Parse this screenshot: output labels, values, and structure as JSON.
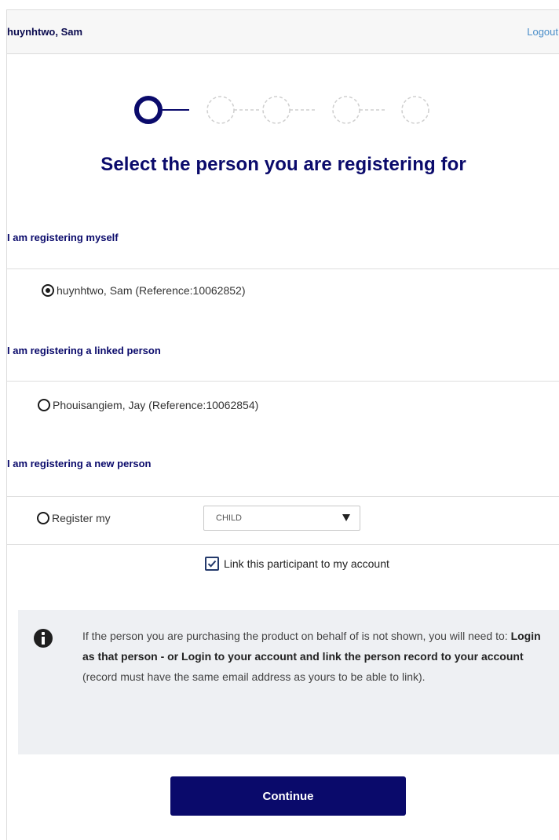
{
  "header": {
    "user_name": "huynhtwo, Sam",
    "logout_label": "Logout"
  },
  "stepper": {
    "total_steps": 5,
    "current_step": 1
  },
  "page": {
    "title": "Select the person you are registering for"
  },
  "sections": {
    "myself": {
      "heading": "I am registering myself",
      "option_label": "huynhtwo, Sam (Reference:10062852)",
      "selected": true
    },
    "linked": {
      "heading": "I am registering a linked person",
      "option_label": "Phouisangiem, Jay (Reference:10062854)",
      "selected": false
    },
    "new_person": {
      "heading": "I am registering a new person",
      "option_label": "Register my",
      "selected": false,
      "relation_select": {
        "selected_value": "CHILD"
      },
      "link_checkbox": {
        "label": "Link this participant to my account",
        "checked": true
      }
    }
  },
  "info": {
    "text_intro": "If the person you are purchasing the product on behalf of is not shown, you will need to:",
    "text_bold": "Login as that person - or Login to your account and link the person record to your account",
    "text_note": "(record must have the same email address as yours to be able to link)."
  },
  "actions": {
    "continue_label": "Continue"
  },
  "colors": {
    "primary": "#0a0a6b",
    "link": "#4a8ec9",
    "info_background": "#eef0f3"
  }
}
